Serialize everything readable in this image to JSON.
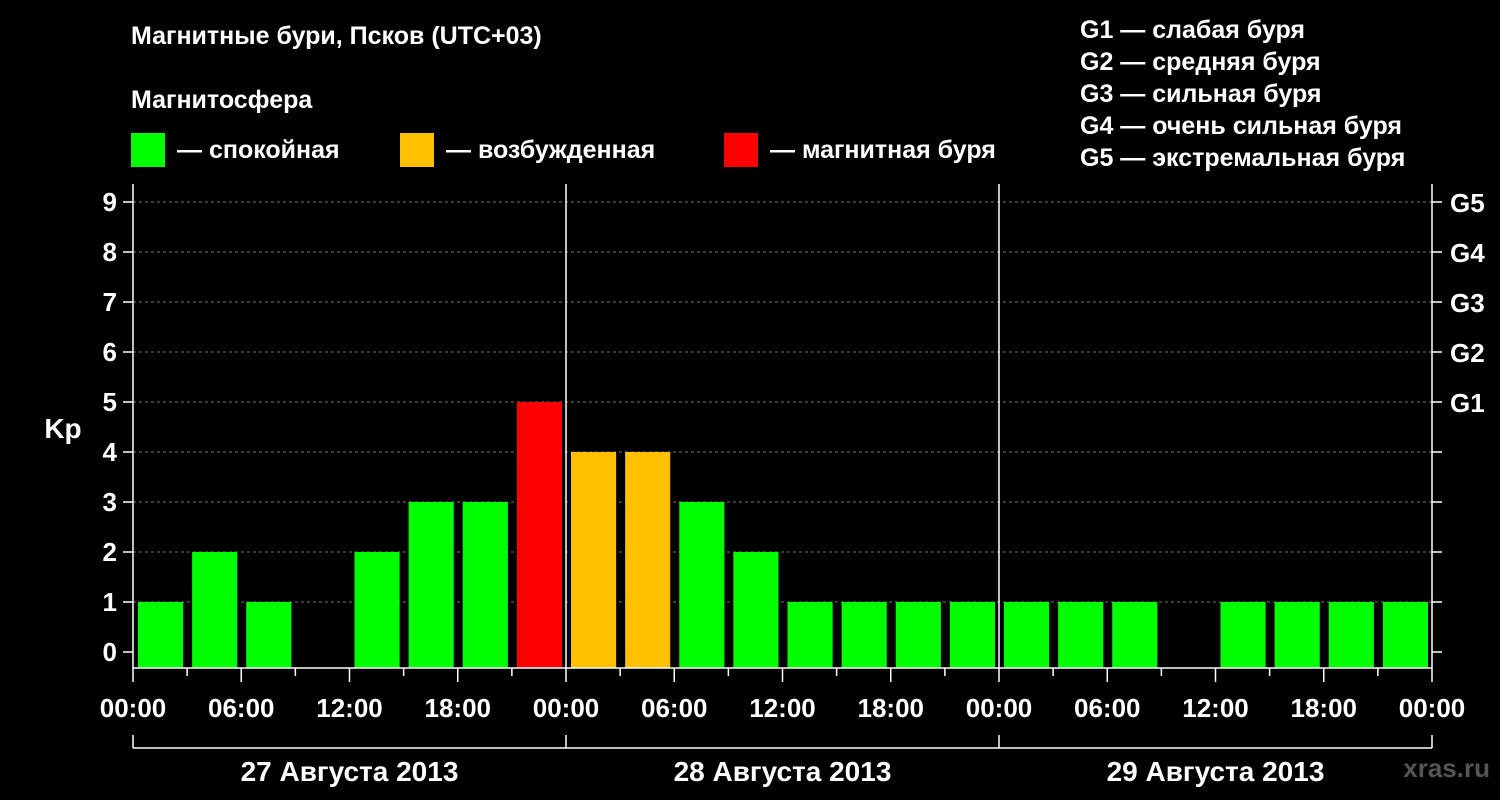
{
  "title": "Магнитные бури, Псков (UTC+03)",
  "subtitle": "Магнитосфера",
  "legend": [
    {
      "label": "— спокойная",
      "color": "#00ff00"
    },
    {
      "label": "— возбужденная",
      "color": "#ffc000"
    },
    {
      "label": "— магнитная буря",
      "color": "#ff0000"
    }
  ],
  "g_legend": [
    "G1 — слабая буря",
    "G2 — средняя буря",
    "G3 — сильная буря",
    "G4 — очень сильная буря",
    "G5 — экстремальная буря"
  ],
  "watermark": "xras.ru",
  "chart_data": {
    "type": "bar",
    "ylabel": "Kp",
    "ylim": [
      0,
      9
    ],
    "y_ticks": [
      0,
      1,
      2,
      3,
      4,
      5,
      6,
      7,
      8,
      9
    ],
    "right_axis_labels": [
      {
        "kp": 5,
        "label": "G1"
      },
      {
        "kp": 6,
        "label": "G2"
      },
      {
        "kp": 7,
        "label": "G3"
      },
      {
        "kp": 8,
        "label": "G4"
      },
      {
        "kp": 9,
        "label": "G5"
      }
    ],
    "x_tick_labels": [
      "00:00",
      "06:00",
      "12:00",
      "18:00",
      "00:00",
      "06:00",
      "12:00",
      "18:00",
      "00:00",
      "06:00",
      "12:00",
      "18:00",
      "00:00"
    ],
    "days": [
      "27 Августа 2013",
      "28 Августа 2013",
      "29 Августа 2013"
    ],
    "interval_hours": 3,
    "values": [
      1,
      2,
      1,
      0,
      2,
      3,
      3,
      5,
      4,
      4,
      3,
      2,
      1,
      1,
      1,
      1,
      1,
      1,
      1,
      0,
      1,
      1,
      1,
      1
    ],
    "colors": {
      "quiet": "#00ff00",
      "active": "#ffc000",
      "storm": "#ff0000"
    },
    "grid": "dashed horizontal"
  }
}
